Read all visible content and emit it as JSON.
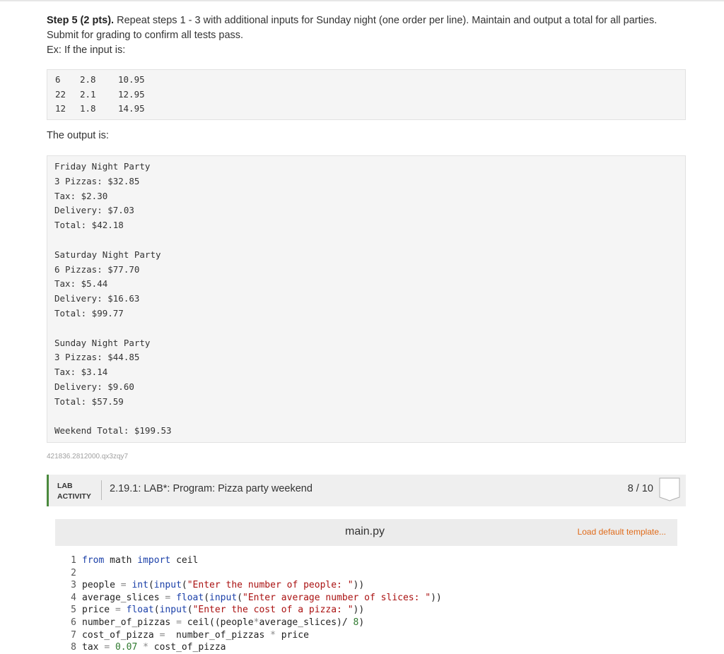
{
  "instructions": {
    "step_label": "Step 5 (2 pts).",
    "step_text": "Repeat steps 1 - 3 with additional inputs for Sunday night (one order per line). Maintain and output a total for all parties.",
    "submit_text": "Submit for grading to confirm all tests pass.",
    "example_intro": "Ex: If the input is:",
    "output_intro": "The output is:"
  },
  "example_input": [
    [
      "6",
      "2.8",
      "10.95"
    ],
    [
      "22",
      "2.1",
      "12.95"
    ],
    [
      "12",
      "1.8",
      "14.95"
    ]
  ],
  "example_output": "Friday Night Party\n3 Pizzas: $32.85\nTax: $2.30\nDelivery: $7.03\nTotal: $42.18\n\nSaturday Night Party\n6 Pizzas: $77.70\nTax: $5.44\nDelivery: $16.63\nTotal: $99.77\n\nSunday Night Party\n3 Pizzas: $44.85\nTax: $3.14\nDelivery: $9.60\nTotal: $57.59\n\nWeekend Total: $199.53",
  "content_id": "421836.2812000.qx3zqy7",
  "lab": {
    "type_line1": "LAB",
    "type_line2": "ACTIVITY",
    "title": "2.19.1: LAB*: Program: Pizza party weekend",
    "score": "8 / 10",
    "accent_color": "#4a8a3d"
  },
  "editor": {
    "file_name": "main.py",
    "load_template_label": "Load default template...",
    "code_lines": [
      {
        "n": "1",
        "code": "from math import ceil"
      },
      {
        "n": "2",
        "code": ""
      },
      {
        "n": "3",
        "code": "people = int(input(\"Enter the number of people: \"))"
      },
      {
        "n": "4",
        "code": "average_slices = float(input(\"Enter average number of slices: \"))"
      },
      {
        "n": "5",
        "code": "price = float(input(\"Enter the cost of a pizza: \"))"
      },
      {
        "n": "6",
        "code": "number_of_pizzas = ceil((people*average_slices)/ 8)"
      },
      {
        "n": "7",
        "code": "cost_of_pizza =  number_of_pizzas * price"
      },
      {
        "n": "8",
        "code": "tax = 0.07 * cost_of_pizza"
      }
    ]
  }
}
